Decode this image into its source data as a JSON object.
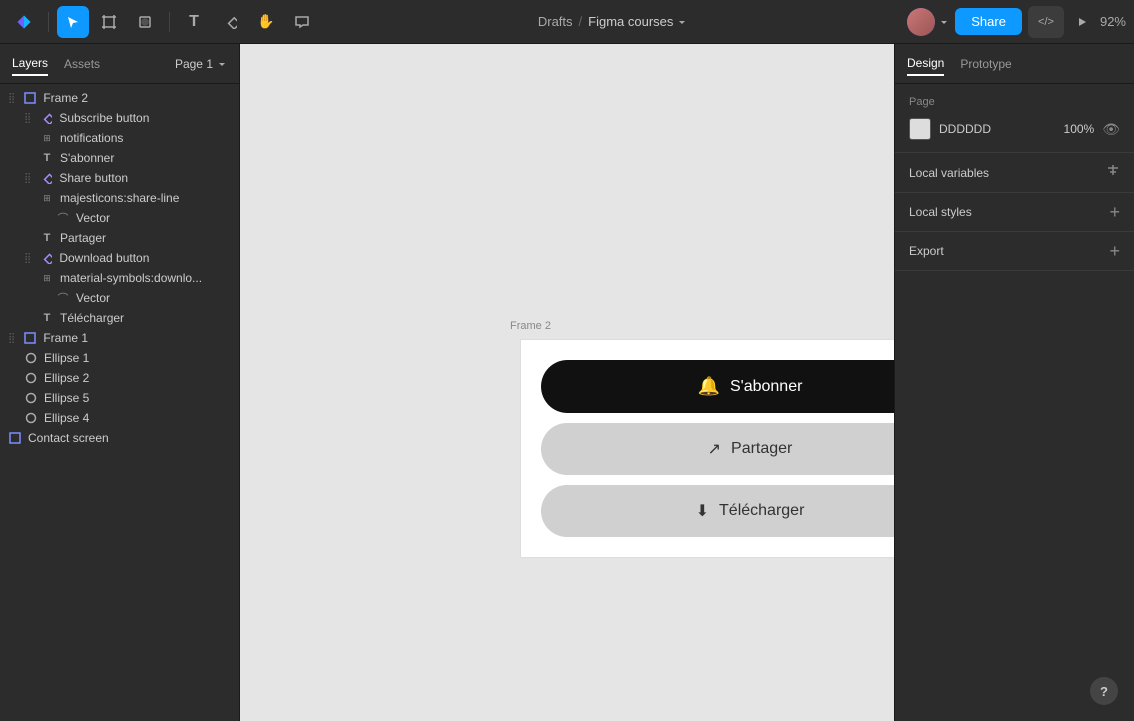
{
  "toolbar": {
    "breadcrumb_drafts": "Drafts",
    "breadcrumb_sep": "/",
    "project_name": "Figma courses",
    "share_label": "Share",
    "zoom": "92%"
  },
  "left_panel": {
    "tab_layers": "Layers",
    "tab_assets": "Assets",
    "page_selector": "Page 1",
    "layers": [
      {
        "id": "frame2",
        "label": "Frame 2",
        "indent": 0,
        "icon": "frame",
        "has_drag": true
      },
      {
        "id": "subscribe-btn",
        "label": "Subscribe button",
        "indent": 1,
        "icon": "component",
        "has_drag": true
      },
      {
        "id": "notifications",
        "label": "notifications",
        "indent": 2,
        "icon": "grid"
      },
      {
        "id": "sabonner-text",
        "label": "S'abonner",
        "indent": 2,
        "icon": "text"
      },
      {
        "id": "share-btn",
        "label": "Share button",
        "indent": 1,
        "icon": "component",
        "has_drag": true
      },
      {
        "id": "majesticons",
        "label": "majesticons:share-line",
        "indent": 2,
        "icon": "grid"
      },
      {
        "id": "vector1",
        "label": "Vector",
        "indent": 3,
        "icon": "vector"
      },
      {
        "id": "partager-text",
        "label": "Partager",
        "indent": 2,
        "icon": "text"
      },
      {
        "id": "download-btn",
        "label": "Download button",
        "indent": 1,
        "icon": "component",
        "has_drag": true
      },
      {
        "id": "material-symbols",
        "label": "material-symbols:downlo...",
        "indent": 2,
        "icon": "grid"
      },
      {
        "id": "vector2",
        "label": "Vector",
        "indent": 3,
        "icon": "vector"
      },
      {
        "id": "telecharger-text",
        "label": "Télécharger",
        "indent": 2,
        "icon": "text"
      },
      {
        "id": "frame1",
        "label": "Frame 1",
        "indent": 0,
        "icon": "frame",
        "has_drag": true
      },
      {
        "id": "ellipse1",
        "label": "Ellipse 1",
        "indent": 1,
        "icon": "ellipse"
      },
      {
        "id": "ellipse2",
        "label": "Ellipse 2",
        "indent": 1,
        "icon": "ellipse"
      },
      {
        "id": "ellipse5",
        "label": "Ellipse 5",
        "indent": 1,
        "icon": "ellipse"
      },
      {
        "id": "ellipse4",
        "label": "Ellipse 4",
        "indent": 1,
        "icon": "ellipse"
      },
      {
        "id": "contact",
        "label": "Contact screen",
        "indent": 0,
        "icon": "frame"
      }
    ]
  },
  "canvas": {
    "frame_label": "Frame 2",
    "subscribe_label": "S'abonner",
    "share_label": "Partager",
    "download_label": "Télécharger"
  },
  "right_panel": {
    "tab_design": "Design",
    "tab_prototype": "Prototype",
    "page_section": "Page",
    "color_hex": "DDDDDD",
    "opacity": "100%",
    "local_variables_label": "Local variables",
    "local_styles_label": "Local styles",
    "export_label": "Export"
  }
}
